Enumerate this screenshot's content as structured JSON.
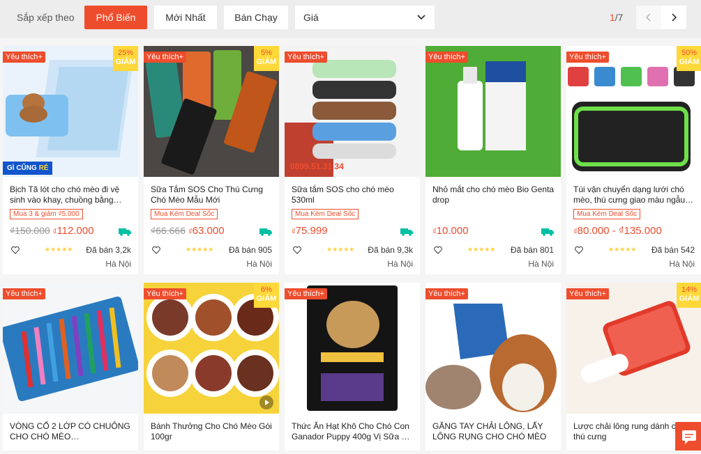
{
  "sort": {
    "label": "Sắp xếp theo",
    "options": [
      "Phổ Biến",
      "Mới Nhất",
      "Bán Chạy"
    ],
    "price_label": "Giá",
    "page_current": "1",
    "page_total": "/7"
  },
  "colors": {
    "accent": "#ee4d2d",
    "star": "#ffce3d",
    "free_ship": "#00bfa5"
  },
  "products": [
    {
      "badge": "Yêu thích+",
      "discount_pct": "25%",
      "discount_word": "GIẢM",
      "title": "Bịch Tã lót cho chó mèo đi vệ sinh vào khay, chuồng bằng…",
      "tag": "Mua 3 & giảm ₫5.000",
      "old_price": "₫150.000",
      "price": "112.000",
      "currency": "₫",
      "stars": "★★★★★",
      "sold": "Đã bán 3,2k",
      "location": "Hà Nội",
      "overlay": "GÌ CŨNG ",
      "overlay_bold": "RẺ"
    },
    {
      "badge": "Yêu thích+",
      "discount_pct": "5%",
      "discount_word": "GIẢM",
      "title": "Sữa Tắm SOS Cho Thú Cưng Chó Mèo Mẫu Mới",
      "tag": "Mua Kèm Deal Sốc",
      "old_price": "₫66.666",
      "price": "63.000",
      "currency": "₫",
      "stars": "★★★★★",
      "sold": "Đã bán 905",
      "location": "Hà Nội"
    },
    {
      "badge": "Yêu thích+",
      "title": "Sữa tắm SOS cho chó mèo 530ml",
      "tag": "Mua Kèm Deal Sốc",
      "price": "75.999",
      "currency": "₫",
      "stars": "★★★★★",
      "sold": "Đã bán 9,3k",
      "location": "Hà Nội",
      "overlay": "0899.51.31.34"
    },
    {
      "badge": "Yêu thích+",
      "title": "Nhỏ mắt cho chó mèo Bio Genta drop",
      "price": "10.000",
      "currency": "₫",
      "stars": "★★★★★",
      "sold": "Đã bán 801",
      "location": "Hà Nội"
    },
    {
      "badge": "Yêu thích+",
      "discount_pct": "50%",
      "discount_word": "GIẢM",
      "title": "Túi vận chuyển dạng lưới chó mèo, thú cưng giao màu ngẫu…",
      "tag": "Mua Kèm Deal Sốc",
      "price": "80.000 - ₫135.000",
      "currency": "₫",
      "stars": "★★★★★",
      "sold": "Đã bán 542",
      "location": "Hà Nội"
    },
    {
      "badge": "Yêu thích+",
      "title": "VÒNG CỔ 2 LỚP CÓ CHUÔNG CHO CHÓ MÈO…"
    },
    {
      "badge": "Yêu thích+",
      "discount_pct": "6%",
      "discount_word": "GIẢM",
      "title": "Bánh Thưởng Cho Chó Mèo Gói 100gr"
    },
    {
      "badge": "Yêu thích+",
      "title": "Thức Ăn Hạt Khô Cho Chó Con Ganador Puppy 400g Vị Sữa …"
    },
    {
      "badge": "Yêu thích+",
      "title": "GĂNG TAY CHẢI LÔNG, LẤY LÔNG RỤNG CHO CHÓ MÈO"
    },
    {
      "badge": "Yêu thích+",
      "discount_pct": "14%",
      "discount_word": "GIẢM",
      "title": "Lược chải lông rung dành cho thú cưng"
    }
  ]
}
